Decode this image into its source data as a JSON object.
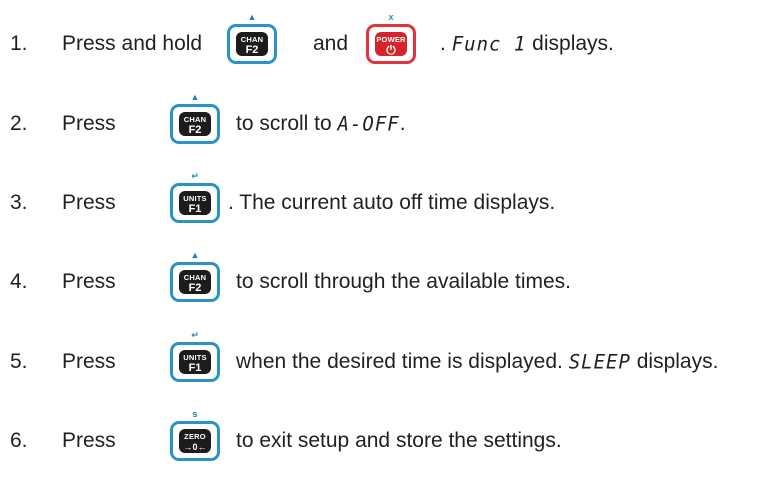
{
  "colors": {
    "key_border": "#2a93c6",
    "power_border": "#e0333c",
    "power_cap": "#d8232a",
    "cap": "#1c1c1c",
    "text": "#231f20"
  },
  "keys": {
    "chan": {
      "top": "CHAN",
      "bottom": "F2",
      "symbol": "▲",
      "icon": "up-triangle-icon"
    },
    "power": {
      "top": "POWER",
      "bottom": "⏻",
      "symbol": "x",
      "icon": "power-icon"
    },
    "units": {
      "top": "UNITS",
      "bottom": "F1",
      "symbol": "↵",
      "icon": "return-arrow-icon"
    },
    "zero": {
      "top": "ZERO",
      "bottom": "→0←",
      "symbol": "s",
      "icon": "zero-arrows-icon"
    }
  },
  "steps": [
    {
      "number": "1.",
      "press": "Press and hold",
      "and": "and",
      "dot": ".",
      "display": "Func 1",
      "after": "displays."
    },
    {
      "number": "2.",
      "press": "Press",
      "text": "to scroll to",
      "display": "A-OFF",
      "after": "."
    },
    {
      "number": "3.",
      "press": "Press",
      "text": ". The current auto off time displays."
    },
    {
      "number": "4.",
      "press": "Press",
      "text": "to scroll through the available times."
    },
    {
      "number": "5.",
      "press": "Press",
      "text": "when the desired time is displayed.",
      "display": "SLEEP",
      "after": "displays."
    },
    {
      "number": "6.",
      "press": "Press",
      "text": "to exit setup and store the settings."
    }
  ]
}
